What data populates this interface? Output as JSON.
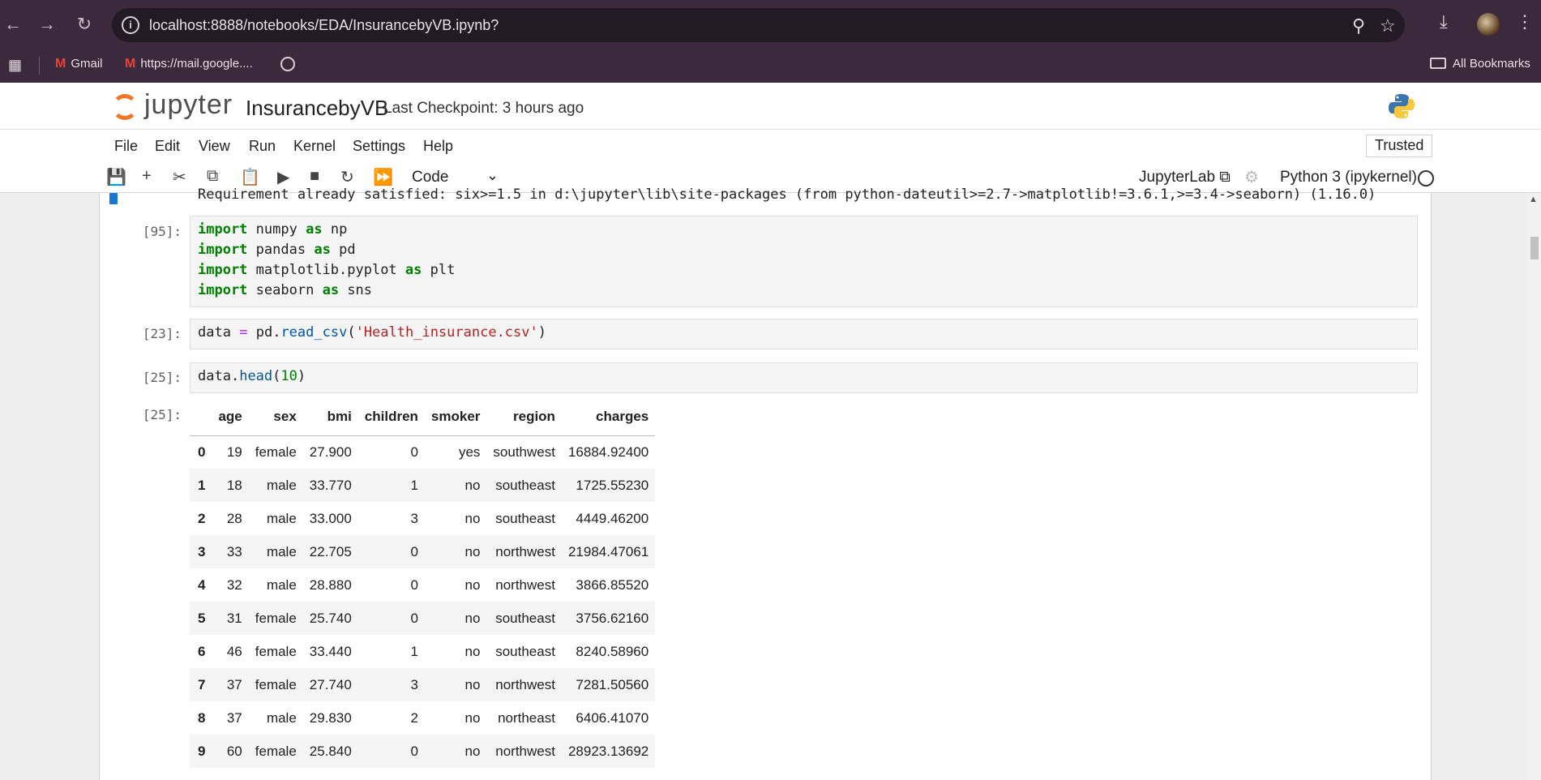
{
  "browser": {
    "url": "localhost:8888/notebooks/EDA/InsurancebyVB.ipynb?",
    "bookmarks": [
      {
        "label": "Gmail"
      },
      {
        "label": "https://mail.google...."
      }
    ],
    "all_bookmarks_label": "All Bookmarks"
  },
  "jupyter": {
    "logo_text": "jupyter",
    "notebook_title": "InsurancebyVB",
    "checkpoint": "Last Checkpoint: 3 hours ago",
    "menu": [
      "File",
      "Edit",
      "View",
      "Run",
      "Kernel",
      "Settings",
      "Help"
    ],
    "trusted_label": "Trusted",
    "cell_type": "Code",
    "jupyterlab_label": "JupyterLab",
    "kernel_label": "Python 3 (ipykernel)"
  },
  "notebook": {
    "previous_output": "Requirement already satisfied: six>=1.5 in d:\\jupyter\\lib\\site-packages (from python-dateutil>=2.7->matplotlib!=3.6.1,>=3.4->seaborn) (1.16.0)",
    "cells": [
      {
        "prompt": "[95]:",
        "type": "imports"
      },
      {
        "prompt": "[23]:",
        "type": "read_csv"
      },
      {
        "prompt": "[25]:",
        "type": "head"
      },
      {
        "prompt": "[25]:",
        "type": "output"
      }
    ],
    "code": {
      "imports": [
        {
          "mod": "numpy",
          "alias": "np"
        },
        {
          "mod": "pandas",
          "alias": "pd"
        },
        {
          "mod": "matplotlib.pyplot",
          "alias": "plt"
        },
        {
          "mod": "seaborn",
          "alias": "sns"
        }
      ],
      "read_csv": {
        "var": "data",
        "obj": "pd",
        "fn": "read_csv",
        "arg": "'Health_insurance.csv'"
      },
      "head": {
        "var": "data",
        "fn": "head",
        "arg": "10"
      }
    },
    "dataframe": {
      "columns": [
        "age",
        "sex",
        "bmi",
        "children",
        "smoker",
        "region",
        "charges"
      ],
      "rows": [
        [
          "0",
          "19",
          "female",
          "27.900",
          "0",
          "yes",
          "southwest",
          "16884.92400"
        ],
        [
          "1",
          "18",
          "male",
          "33.770",
          "1",
          "no",
          "southeast",
          "1725.55230"
        ],
        [
          "2",
          "28",
          "male",
          "33.000",
          "3",
          "no",
          "southeast",
          "4449.46200"
        ],
        [
          "3",
          "33",
          "male",
          "22.705",
          "0",
          "no",
          "northwest",
          "21984.47061"
        ],
        [
          "4",
          "32",
          "male",
          "28.880",
          "0",
          "no",
          "northwest",
          "3866.85520"
        ],
        [
          "5",
          "31",
          "female",
          "25.740",
          "0",
          "no",
          "southeast",
          "3756.62160"
        ],
        [
          "6",
          "46",
          "female",
          "33.440",
          "1",
          "no",
          "southeast",
          "8240.58960"
        ],
        [
          "7",
          "37",
          "female",
          "27.740",
          "3",
          "no",
          "northwest",
          "7281.50560"
        ],
        [
          "8",
          "37",
          "male",
          "29.830",
          "2",
          "no",
          "northeast",
          "6406.41070"
        ],
        [
          "9",
          "60",
          "female",
          "25.840",
          "0",
          "no",
          "northwest",
          "28923.13692"
        ]
      ]
    }
  }
}
